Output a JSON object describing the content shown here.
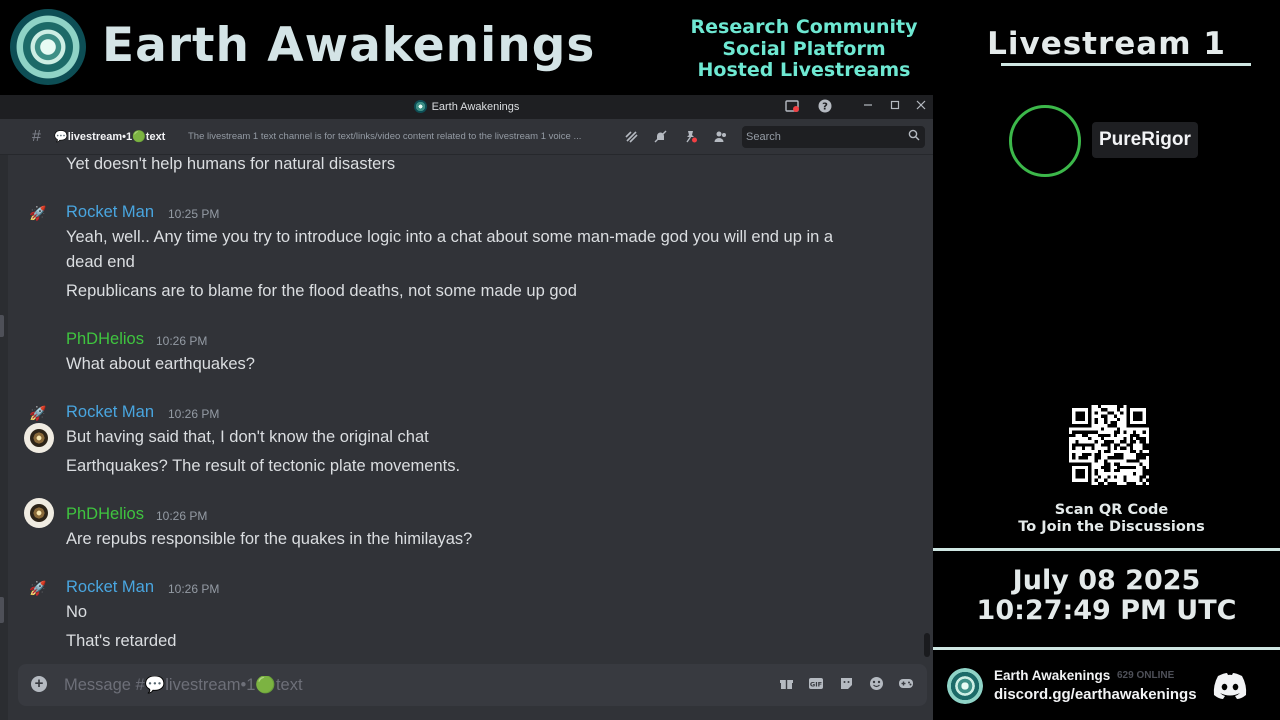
{
  "banner": {
    "title": "Earth Awakenings",
    "tagline": [
      "Research Community",
      "Social Platform",
      "Hosted Livestreams"
    ]
  },
  "window": {
    "title": "Earth Awakenings"
  },
  "channel": {
    "name": "💬livestream•1🟢text",
    "topic": "The livestream 1 text channel is for text/links/video content related to the livestream 1 voice ...",
    "search_placeholder": "Search"
  },
  "messages": [
    {
      "text": "Yet doesn't help humans for natural disasters"
    },
    {
      "author": "Rocket Man",
      "time": "10:25 PM",
      "lines": [
        "Yeah, well.. Any time you try to introduce logic into a chat about some man-made god you will end up in a",
        "dead end",
        "Republicans are to blame for the flood deaths, not some made up god"
      ]
    },
    {
      "author": "PhDHelios",
      "time": "10:26 PM",
      "lines": [
        "What about earthquakes?"
      ]
    },
    {
      "author": "Rocket Man",
      "time": "10:26 PM",
      "lines": [
        "But having said that, I don't know the original chat",
        "Earthquakes? The result of tectonic plate movements."
      ]
    },
    {
      "author": "PhDHelios",
      "time": "10:26 PM",
      "lines": [
        "Are repubs responsible for the quakes in the himilayas?"
      ]
    },
    {
      "author": "Rocket Man",
      "time": "10:26 PM",
      "lines": [
        "No",
        "That's retarded"
      ]
    }
  ],
  "composer": {
    "placeholder": "Message #💬livestream•1🟢text"
  },
  "sidepanel": {
    "livestream_title": "Livestream 1",
    "speaker": "PureRigor",
    "scan_line1": "Scan QR Code",
    "scan_line2": "To Join the Discussions",
    "date": "July 08 2025",
    "time": "10:27:49 PM UTC",
    "server_name": "Earth Awakenings",
    "online": "629 ONLINE",
    "invite_link": "discord.gg/earthawakenings"
  },
  "colors": {
    "rocket_man": "#49a6e0",
    "phdhelios": "#3fc43f",
    "tagline": "#6ee8d2",
    "speaker_ring": "#3cb84a"
  }
}
